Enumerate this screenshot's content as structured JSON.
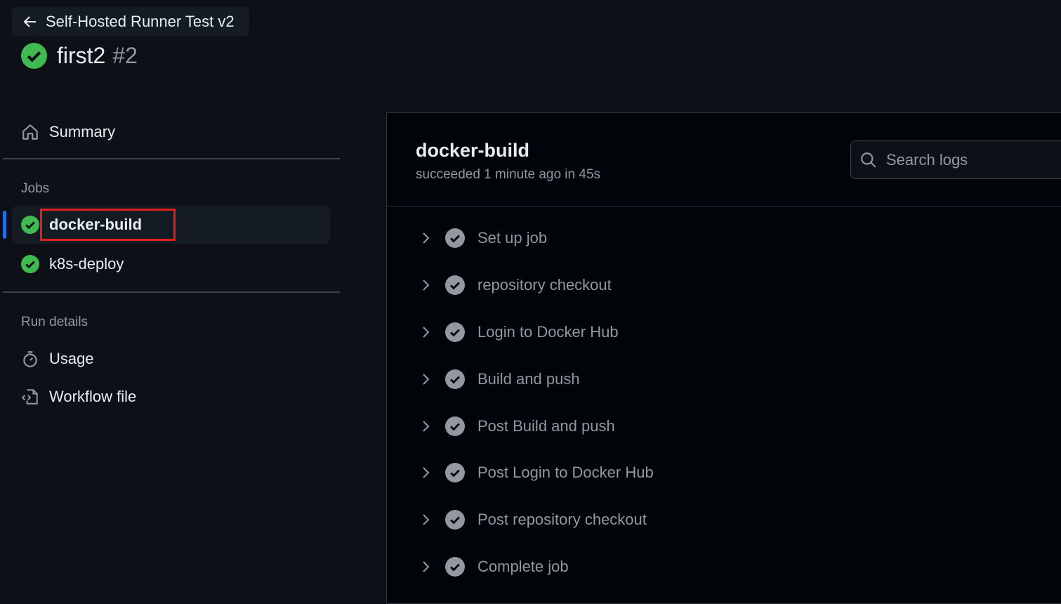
{
  "header": {
    "back_label": "Self-Hosted Runner Test v2",
    "run_title": "first2",
    "run_number": "#2"
  },
  "sidebar": {
    "summary_label": "Summary",
    "jobs_heading": "Jobs",
    "jobs": [
      {
        "label": "docker-build"
      },
      {
        "label": "k8s-deploy"
      }
    ],
    "run_details_heading": "Run details",
    "usage_label": "Usage",
    "workflow_file_label": "Workflow file"
  },
  "job": {
    "name": "docker-build",
    "status": "succeeded 1 minute ago in 45s",
    "search_placeholder": "Search logs"
  },
  "steps": [
    {
      "label": "Set up job"
    },
    {
      "label": "repository checkout"
    },
    {
      "label": "Login to Docker Hub"
    },
    {
      "label": "Build and push"
    },
    {
      "label": "Post Build and push"
    },
    {
      "label": "Post Login to Docker Hub"
    },
    {
      "label": "Post repository checkout"
    },
    {
      "label": "Complete job"
    }
  ],
  "colors": {
    "success": "#3fb950",
    "accent": "#1f6feb",
    "highlight": "#e11d1d"
  }
}
